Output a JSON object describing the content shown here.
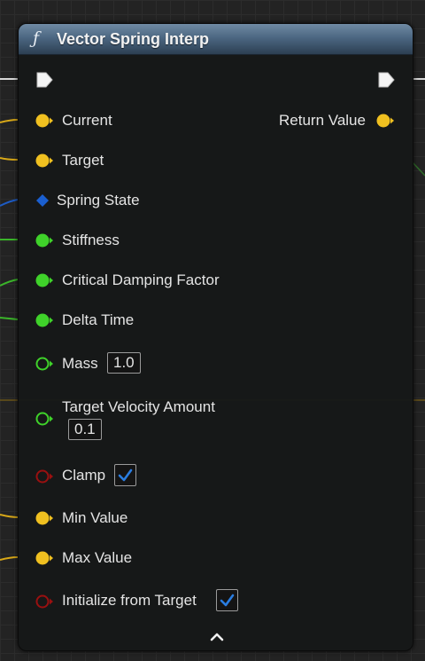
{
  "node": {
    "title": "Vector Spring Interp",
    "function_icon": "function-icon",
    "header_color": "#4c6782"
  },
  "pins": {
    "exec_in": {
      "icon": "exec-arrow-icon"
    },
    "exec_out": {
      "icon": "exec-arrow-icon"
    },
    "current": {
      "label": "Current",
      "type": "vector",
      "color": "#f0c020"
    },
    "target": {
      "label": "Target",
      "type": "vector",
      "color": "#f0c020"
    },
    "spring_state": {
      "label": "Spring State",
      "type": "struct",
      "color": "#1a5fd0"
    },
    "stiffness": {
      "label": "Stiffness",
      "type": "float",
      "color": "#3fd22a"
    },
    "critical_damping": {
      "label": "Critical Damping Factor",
      "type": "float",
      "color": "#3fd22a"
    },
    "delta_time": {
      "label": "Delta Time",
      "type": "float",
      "color": "#3fd22a"
    },
    "mass": {
      "label": "Mass",
      "type": "float",
      "value": "1.0",
      "color": "#3fd22a"
    },
    "target_velocity_amount": {
      "label": "Target Velocity Amount",
      "type": "float",
      "value": "0.1",
      "color": "#3fd22a"
    },
    "clamp": {
      "label": "Clamp",
      "type": "bool",
      "checked": true,
      "color": "#9a1010"
    },
    "min_value": {
      "label": "Min Value",
      "type": "vector",
      "color": "#f0c020"
    },
    "max_value": {
      "label": "Max Value",
      "type": "vector",
      "color": "#f0c020"
    },
    "initialize_from_target": {
      "label": "Initialize from Target",
      "type": "bool",
      "checked": true,
      "color": "#9a1010"
    },
    "return_value": {
      "label": "Return Value",
      "type": "vector",
      "color": "#f0c020"
    }
  },
  "footer": {
    "icon": "chevron-up-icon"
  },
  "colors": {
    "background": "#232323",
    "check_mark": "#2a7de1"
  }
}
